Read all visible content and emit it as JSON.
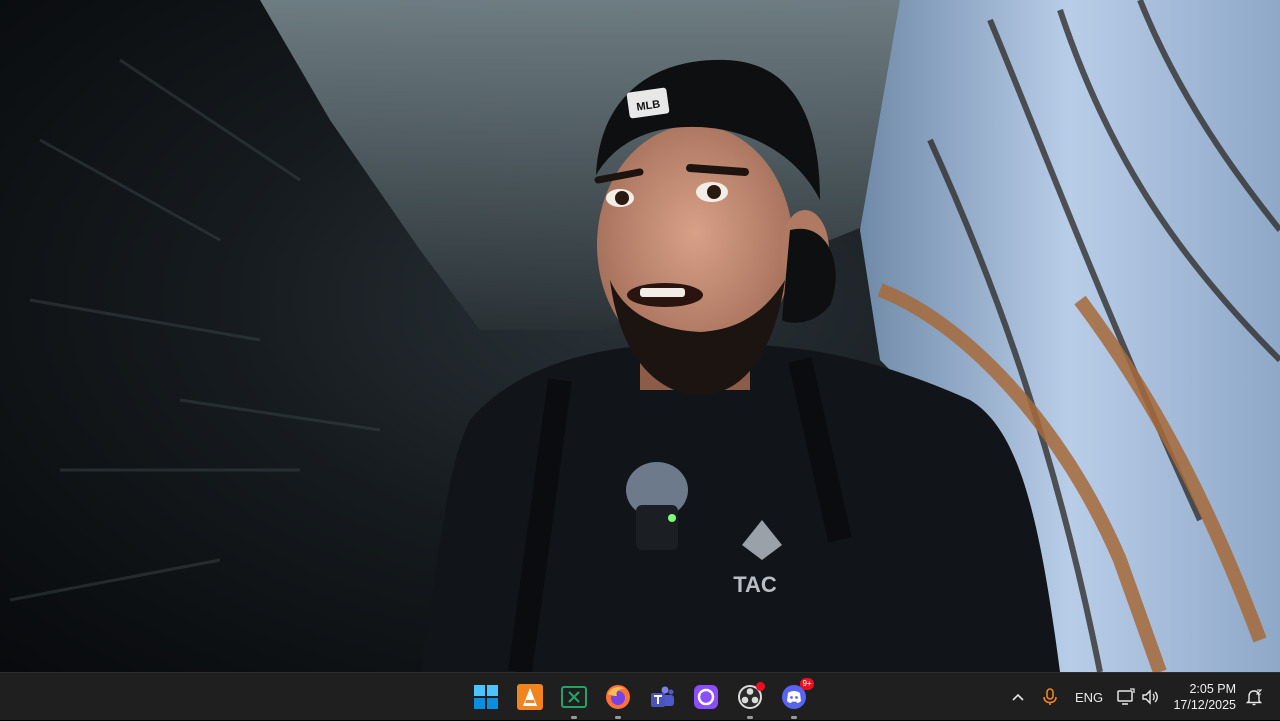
{
  "video": {
    "subject": "person-in-cave-selfie",
    "shirt_text": "TAC",
    "cap_logo": "MLB"
  },
  "taskbar": {
    "apps": [
      {
        "name": "start",
        "icon": "windows-logo-icon",
        "running": false
      },
      {
        "name": "vlc",
        "icon": "vlc-cone-icon",
        "running": false
      },
      {
        "name": "excel",
        "icon": "excel-icon",
        "running": true
      },
      {
        "name": "firefox",
        "icon": "firefox-icon",
        "running": true
      },
      {
        "name": "teams",
        "icon": "teams-icon",
        "running": false
      },
      {
        "name": "app-circle",
        "icon": "purple-circle-icon",
        "running": false
      },
      {
        "name": "obs",
        "icon": "obs-icon",
        "running": true,
        "notification": true
      },
      {
        "name": "discord",
        "icon": "discord-icon",
        "running": true,
        "badge": "9+"
      }
    ],
    "tray": {
      "language": "ENG",
      "time": "2:05 PM",
      "date": "17/12/2025"
    }
  },
  "colors": {
    "taskbar_bg": "#1f1f1f",
    "badge": "#e81123",
    "windows_blue": "#0078d4",
    "excel_green": "#107c41",
    "discord": "#5865f2"
  }
}
